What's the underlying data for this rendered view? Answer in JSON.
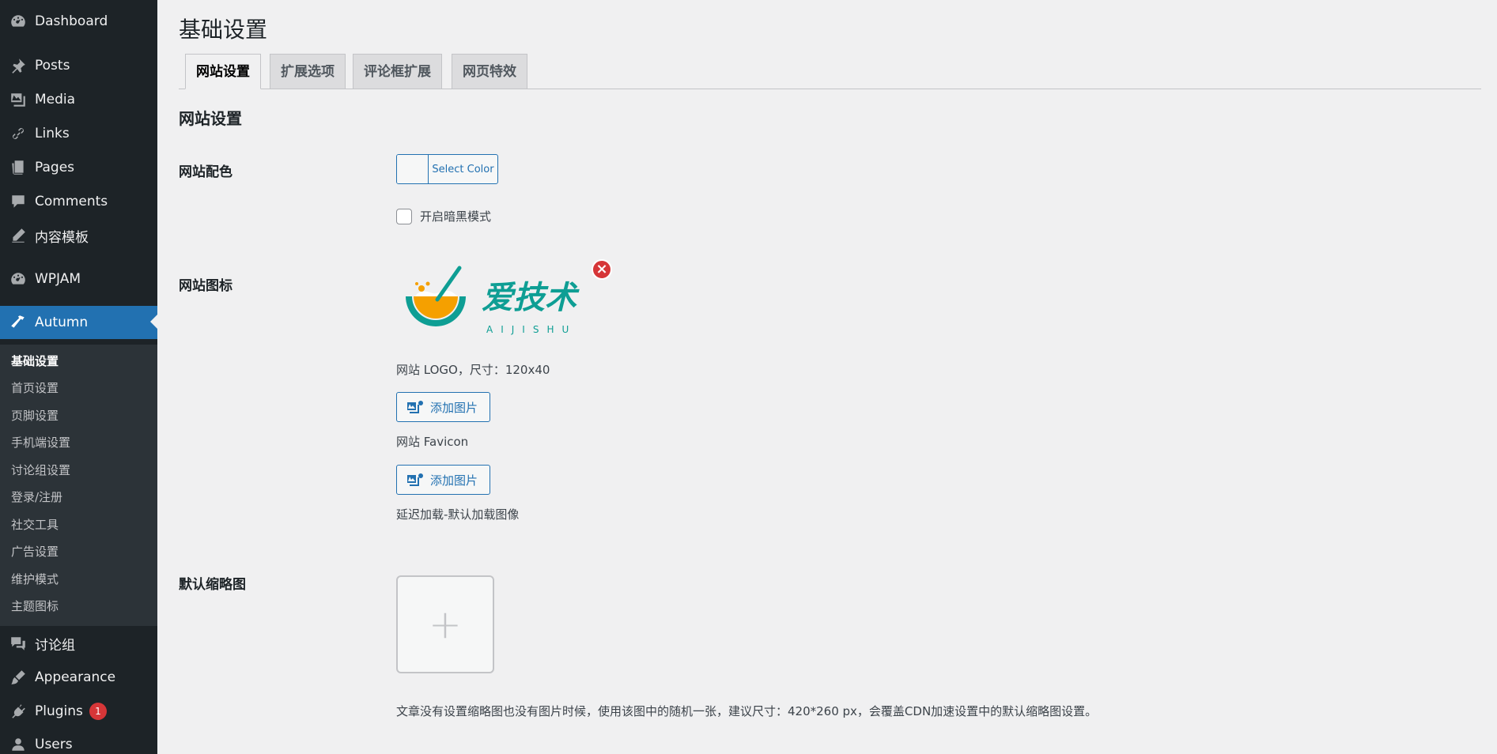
{
  "sidebar": {
    "items": [
      {
        "label": "Dashboard",
        "icon": "dashboard-icon"
      },
      {
        "label": "Posts",
        "icon": "pin-icon"
      },
      {
        "label": "Media",
        "icon": "media-icon"
      },
      {
        "label": "Links",
        "icon": "link-icon"
      },
      {
        "label": "Pages",
        "icon": "pages-icon"
      },
      {
        "label": "Comments",
        "icon": "comment-icon"
      },
      {
        "label": "内容模板",
        "icon": "edit-icon"
      },
      {
        "label": "WPJAM",
        "icon": "dashboard-icon"
      },
      {
        "label": "Autumn",
        "icon": "hammer-icon"
      },
      {
        "label": "讨论组",
        "icon": "groups-icon"
      },
      {
        "label": "Appearance",
        "icon": "brush-icon"
      },
      {
        "label": "Plugins",
        "icon": "plugin-icon",
        "badge": "1"
      },
      {
        "label": "Users",
        "icon": "user-icon"
      }
    ],
    "submenu": [
      "基础设置",
      "首页设置",
      "页脚设置",
      "手机端设置",
      "讨论组设置",
      "登录/注册",
      "社交工具",
      "广告设置",
      "维护模式",
      "主题图标"
    ]
  },
  "page": {
    "title": "基础设置",
    "tabs": [
      "网站设置",
      "扩展选项",
      "评论框扩展",
      "网页特效"
    ],
    "section_title": "网站设置"
  },
  "fields": {
    "color": {
      "label": "网站配色",
      "button_label": "Select Color",
      "dark_mode_label": "开启暗黑模式"
    },
    "icon": {
      "label": "网站图标",
      "logo_text": "爱技术",
      "logo_subtext": "AIJISHU",
      "logo_help": "网站 LOGO，尺寸：120x40",
      "add_image_label": "添加图片",
      "favicon_label": "网站 Favicon",
      "lazy_label": "延迟加载-默认加载图像"
    },
    "thumbnail": {
      "label": "默认缩略图",
      "plus": "+",
      "help": "文章没有设置缩略图也没有图片时候，使用该图中的随机一张，建议尺寸：420*260 px，会覆盖CDN加速设置中的默认缩略图设置。"
    }
  },
  "colors": {
    "sidebar_bg": "#1d2327",
    "submenu_bg": "#2c3338",
    "accent": "#2271b1",
    "badge": "#d63638",
    "logo_teal": "#0e9e94",
    "logo_orange": "#f5a000"
  }
}
